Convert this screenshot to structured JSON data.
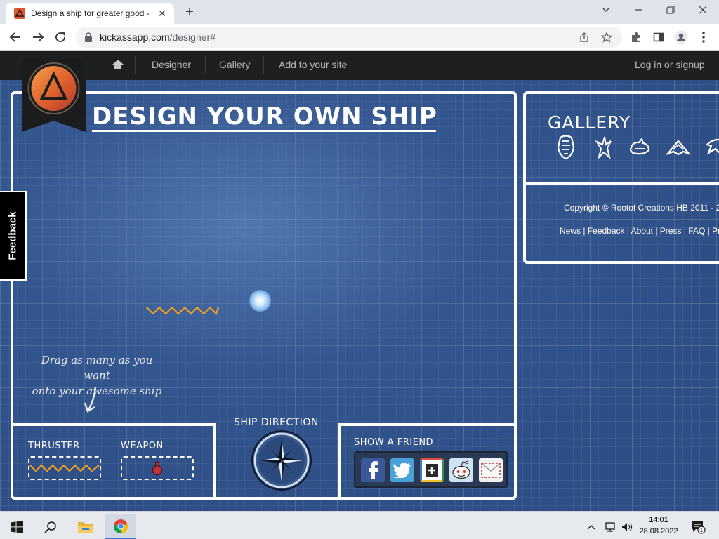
{
  "browser": {
    "tab_title": "Design a ship for greater good -",
    "tab_close": "✕",
    "new_tab": "+",
    "url_domain": "kickassapp.com",
    "url_path": "/designer#",
    "window_controls": [
      "minimize",
      "restore",
      "close"
    ]
  },
  "site_nav": {
    "home_icon": "home-icon",
    "links": [
      "Designer",
      "Gallery",
      "Add to your site"
    ],
    "login": "Log in or signup"
  },
  "designer": {
    "title": "DESIGN YOUR OWN SHIP",
    "drag_hint_line1": "Drag as many as you want",
    "drag_hint_line2": "onto your awesome ship",
    "thruster_label": "THRUSTER",
    "weapon_label": "WEAPON",
    "ship_direction_label": "SHIP DIRECTION",
    "show_friend_label": "SHOW A FRIEND",
    "share_buttons": [
      "facebook",
      "twitter",
      "google-plus",
      "reddit",
      "email"
    ]
  },
  "gallery": {
    "title": "GALLERY",
    "ships": [
      "ship-1",
      "ship-2",
      "ship-3",
      "ship-4",
      "ship-5"
    ]
  },
  "footer": {
    "copyright": "Copyright © Rootof Creations HB 2011 - 2",
    "links": [
      "News",
      "Feedback",
      "About",
      "Press",
      "FAQ",
      "Pr"
    ]
  },
  "feedback_tab": "Feedback",
  "taskbar": {
    "time": "14:01",
    "date": "28.08.2022",
    "notification_count": "1"
  },
  "colors": {
    "blueprint": "#2e4f86",
    "nav_bg": "#1e1f21",
    "thruster_orange": "#f0a020"
  }
}
